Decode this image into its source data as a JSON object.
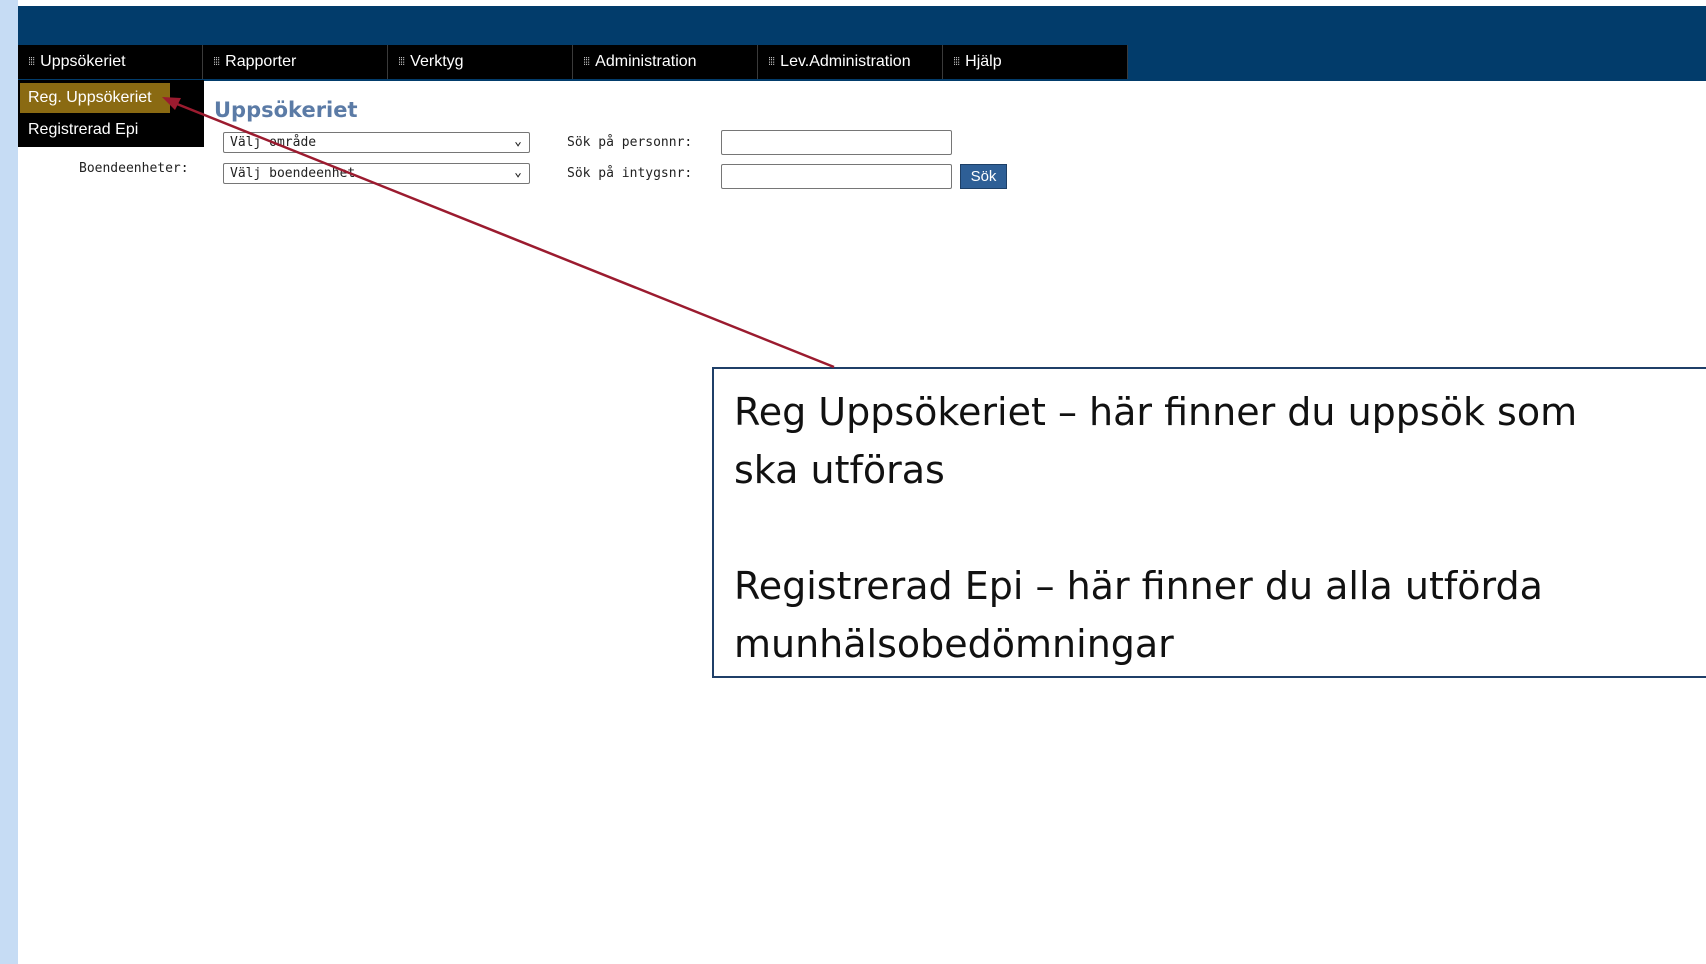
{
  "menubar": {
    "items": [
      {
        "label": "Uppsökeriet"
      },
      {
        "label": "Rapporter"
      },
      {
        "label": "Verktyg"
      },
      {
        "label": "Administration"
      },
      {
        "label": "Lev.Administration"
      },
      {
        "label": "Hjälp"
      }
    ]
  },
  "submenu": {
    "items": [
      {
        "label": "Reg. Uppsökeriet",
        "active": true
      },
      {
        "label": "Registrerad Epi",
        "active": false
      }
    ]
  },
  "main": {
    "title": "Uppsökeriet",
    "area_select": {
      "value": "Välj område"
    },
    "boende_label": "Boendeenheter:",
    "boende_select": {
      "value": "Välj boendeenhet"
    },
    "personnr_label": "Sök på personnr:",
    "personnr_value": "",
    "intygsnr_label": "Sök på intygsnr:",
    "intygsnr_value": "",
    "search_button": "Sök"
  },
  "callout": {
    "line1": "Reg Uppsökeriet – här finner du uppsök som ska utföras",
    "line2": "Registrerad Epi – här finner du alla utförda munhälsobedömningar"
  },
  "colors": {
    "header": "#023c6b",
    "menubar": "#000000",
    "active_submenu": "#8a6a12",
    "title": "#5b7ba6",
    "search_button": "#2e5f96",
    "arrow": "#9b1b2f",
    "left_strip": "#c6dcf4"
  },
  "icons": {
    "menu_grip": "grip-dots-icon",
    "select_chevron": "chevron-down-icon",
    "arrow": "annotation-arrow"
  }
}
